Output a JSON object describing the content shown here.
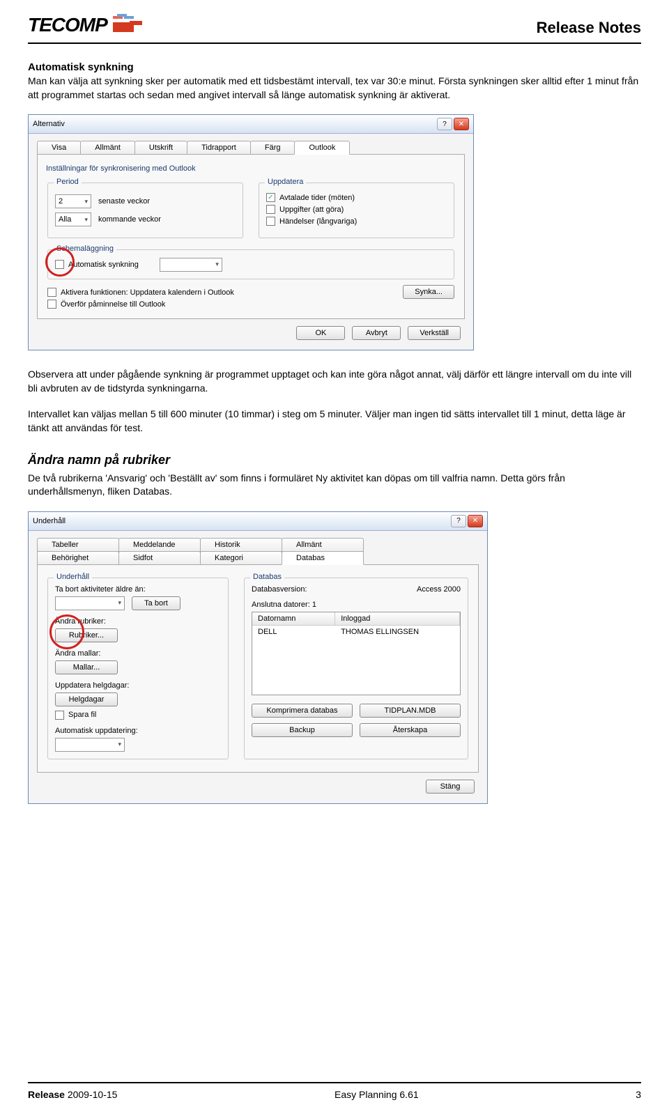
{
  "header": {
    "logo_text": "TECOMP",
    "title": "Release Notes"
  },
  "section1": {
    "title": "Automatisk synkning",
    "para1": "Man kan välja att synkning sker per automatik med ett tidsbestämt intervall, tex var 30:e minut. Första synkningen sker alltid efter 1 minut från att programmet startas och sedan med angivet intervall så länge automatisk synkning är aktiverat."
  },
  "dialog1": {
    "title": "Alternativ",
    "tabs": [
      "Visa",
      "Allmänt",
      "Utskrift",
      "Tidrapport",
      "Färg",
      "Outlook"
    ],
    "active_tab": "Outlook",
    "subheading": "Inställningar för synkronisering med Outlook",
    "period": {
      "legend": "Period",
      "val1": "2",
      "label1": "senaste veckor",
      "val2": "Alla",
      "label2": "kommande veckor"
    },
    "uppdatera": {
      "legend": "Uppdatera",
      "opt1": "Avtalade tider (möten)",
      "opt2": "Uppgifter (att göra)",
      "opt3": "Händelser (långvariga)"
    },
    "schema": {
      "legend": "Schemaläggning",
      "auto": "Automatisk synkning"
    },
    "extra_cb1": "Aktivera funktionen: Uppdatera kalendern i Outlook",
    "extra_cb2": "Överför påminnelse till Outlook",
    "synka_btn": "Synka...",
    "ok": "OK",
    "avbryt": "Avbryt",
    "verkstall": "Verkställ"
  },
  "para_after_dialog1_a": "Observera att under pågående synkning är programmet upptaget och kan inte göra något annat, välj därför ett längre intervall om du inte vill bli avbruten av de tidstyrda synkningarna.",
  "para_after_dialog1_b": "Intervallet kan väljas mellan 5 till 600 minuter (10 timmar) i steg om 5 minuter. Väljer man ingen tid sätts intervallet till 1 minut, detta läge är tänkt att användas för test.",
  "section2": {
    "title": "Ändra namn på rubriker",
    "para": "De två rubrikerna 'Ansvarig' och 'Beställt av' som finns i formuläret Ny aktivitet kan döpas om till valfria namn. Detta görs från underhållsmenyn, fliken Databas."
  },
  "dialog2": {
    "title": "Underhåll",
    "tabs_row1": [
      "Tabeller",
      "Meddelande",
      "Historik",
      "Allmänt"
    ],
    "tabs_row2": [
      "Behörighet",
      "Sidfot",
      "Kategori",
      "Databas"
    ],
    "active_tab": "Databas",
    "underhall": {
      "legend": "Underhåll",
      "label1": "Ta bort aktiviteter äldre än:",
      "btn_tabort": "Ta bort",
      "label2": "Ändra rubriker:",
      "btn_rubriker": "Rubriker...",
      "label3": "Ändra mallar:",
      "btn_mallar": "Mallar...",
      "label4": "Uppdatera helgdagar:",
      "btn_helgdagar": "Helgdagar",
      "cb_spara": "Spara fil",
      "label5": "Automatisk uppdatering:"
    },
    "databas": {
      "legend": "Databas",
      "label_ver": "Databasversion:",
      "val_ver": "Access 2000",
      "label_anslutna": "Anslutna datorer: 1",
      "col1": "Datornamn",
      "col2": "Inloggad",
      "row_c1": "DELL",
      "row_c2": "THOMAS ELLINGSEN",
      "btn_komprimera": "Komprimera databas",
      "btn_tidplan": "TIDPLAN.MDB",
      "btn_backup": "Backup",
      "btn_aterskapa": "Återskapa"
    },
    "stang": "Stäng"
  },
  "footer": {
    "release_label": "Release",
    "release_date": "2009-10-15",
    "center": "Easy Planning 6.61",
    "page": "3"
  }
}
